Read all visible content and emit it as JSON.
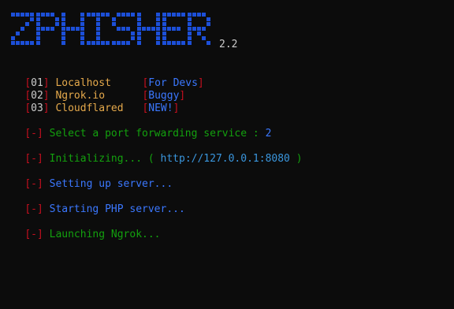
{
  "banner": {
    "title": "ZPHISHER",
    "version": "2.2"
  },
  "menu": [
    {
      "num": "01",
      "label": "Localhost",
      "tag": "For Devs"
    },
    {
      "num": "02",
      "label": "Ngrok.io",
      "tag": "Buggy"
    },
    {
      "num": "03",
      "label": "Cloudflared",
      "tag": "NEW!"
    }
  ],
  "prompt": {
    "marker": "-",
    "text": "Select a port forwarding service : ",
    "value": "2"
  },
  "log": [
    {
      "marker": "-",
      "text": "Initializing... (",
      "url": "http://127.0.0.1:8080",
      "suffix": ")"
    },
    {
      "marker": "-",
      "text": "Setting up server..."
    },
    {
      "marker": "-",
      "text": "Starting PHP server..."
    },
    {
      "marker": "-",
      "text": "Launching Ngrok..."
    }
  ],
  "colors": {
    "background": "#0c0c0c",
    "bracket": "#c50f1f",
    "option": "#e5a94b",
    "tag": "#3b78ff",
    "prompt": "#13a10e",
    "url": "#3a96dd",
    "logo": "#1c4fd8"
  }
}
